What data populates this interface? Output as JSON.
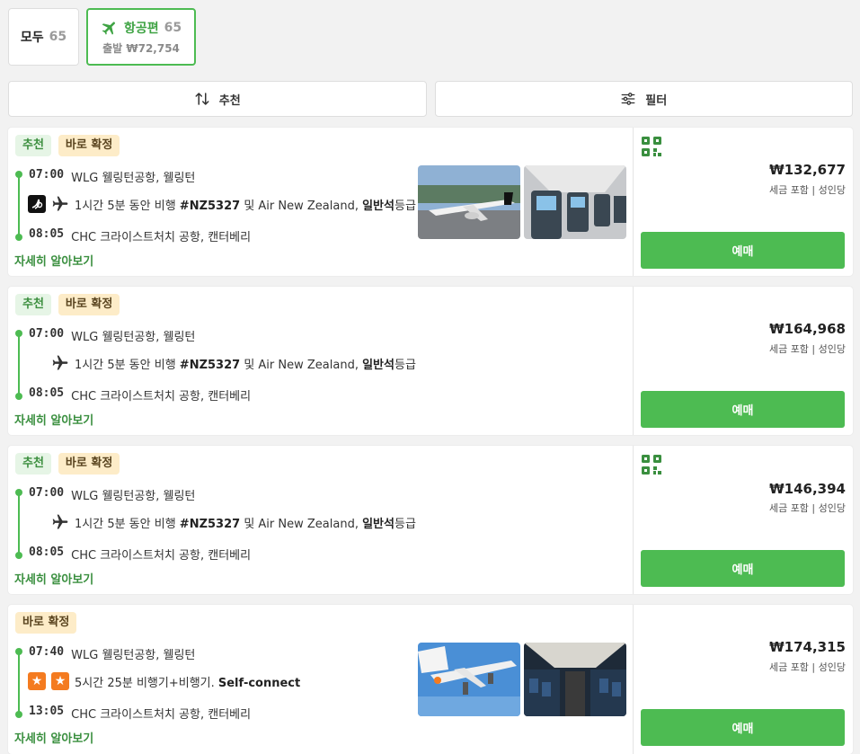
{
  "tabs": {
    "all": {
      "label": "모두",
      "count": "65"
    },
    "flights": {
      "label": "항공편",
      "count": "65",
      "sub": "출발 ₩72,754"
    }
  },
  "toolbar": {
    "sort_label": "추천",
    "filter_label": "필터"
  },
  "cards": [
    {
      "badges": {
        "recommended": "추천",
        "confirmed": "바로 확정"
      },
      "depart": {
        "time": "07:00",
        "place": "WLG 웰링턴공항, 웰링턴"
      },
      "flight": {
        "pre": "1시간 5분 동안 비행 ",
        "code": "#NZ5327",
        "mid": " 및 Air New Zealand, ",
        "cls": "일반석",
        "post": "등급"
      },
      "arrive": {
        "time": "08:05",
        "place": "CHC 크라이스트처치 공항, 캔터베리"
      },
      "details": "자세히 알아보기",
      "price": "₩132,677",
      "price_sub": "세금 포함 | 성인당",
      "book": "예매"
    },
    {
      "badges": {
        "recommended": "추천",
        "confirmed": "바로 확정"
      },
      "depart": {
        "time": "07:00",
        "place": "WLG 웰링턴공항, 웰링턴"
      },
      "flight": {
        "pre": "1시간 5분 동안 비행 ",
        "code": "#NZ5327",
        "mid": " 및 Air New Zealand, ",
        "cls": "일반석",
        "post": "등급"
      },
      "arrive": {
        "time": "08:05",
        "place": "CHC 크라이스트처치 공항, 캔터베리"
      },
      "details": "자세히 알아보기",
      "price": "₩164,968",
      "price_sub": "세금 포함 | 성인당",
      "book": "예매"
    },
    {
      "badges": {
        "recommended": "추천",
        "confirmed": "바로 확정"
      },
      "depart": {
        "time": "07:00",
        "place": "WLG 웰링턴공항, 웰링턴"
      },
      "flight": {
        "pre": "1시간 5분 동안 비행 ",
        "code": "#NZ5327",
        "mid": " 및 Air New Zealand, ",
        "cls": "일반석",
        "post": "등급"
      },
      "arrive": {
        "time": "08:05",
        "place": "CHC 크라이스트처치 공항, 캔터베리"
      },
      "details": "자세히 알아보기",
      "price": "₩146,394",
      "price_sub": "세금 포함 | 성인당",
      "book": "예매"
    },
    {
      "badges": {
        "confirmed": "바로 확정"
      },
      "depart": {
        "time": "07:40",
        "place": "WLG 웰링턴공항, 웰링턴"
      },
      "flight": {
        "pre": "5시간 25분 비행기+비행기. ",
        "code": "Self-connect"
      },
      "arrive": {
        "time": "13:05",
        "place": "CHC 크라이스트처치 공항, 캔터베리"
      },
      "details": "자세히 알아보기",
      "price": "₩174,315",
      "price_sub": "세금 포함 | 성인당",
      "book": "예매"
    }
  ],
  "colors": {
    "accent": "#4dbb52",
    "accent_dark": "#3a8f3f",
    "badge_conf_bg": "#fdecc8",
    "badge_rec_bg": "#e6f5e6"
  }
}
